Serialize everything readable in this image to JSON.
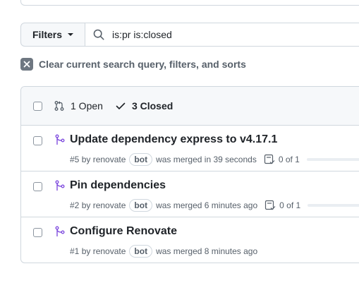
{
  "filter_bar": {
    "filters_label": "Filters",
    "search_value": "is:pr is:closed"
  },
  "clear_label": "Clear current search query, filters, and sorts",
  "header": {
    "open_label": "1 Open",
    "closed_label": "3 Closed"
  },
  "pull_requests": [
    {
      "title": "Update dependency express to v4.17.1",
      "number": "#5",
      "by": "by renovate",
      "badge": "bot",
      "merged_text": "was merged in 39 seconds",
      "tasks": "0 of 1",
      "progress": 0
    },
    {
      "title": "Pin dependencies",
      "number": "#2",
      "by": "by renovate",
      "badge": "bot",
      "merged_text": "was merged 6 minutes ago",
      "tasks": "0 of 1",
      "progress": 0
    },
    {
      "title": "Configure Renovate",
      "number": "#1",
      "by": "by renovate",
      "badge": "bot",
      "merged_text": "was merged 8 minutes ago"
    }
  ],
  "colors": {
    "merged_purple": "#8250df",
    "progress_green": "#1f883d",
    "border": "#d0d7de"
  }
}
